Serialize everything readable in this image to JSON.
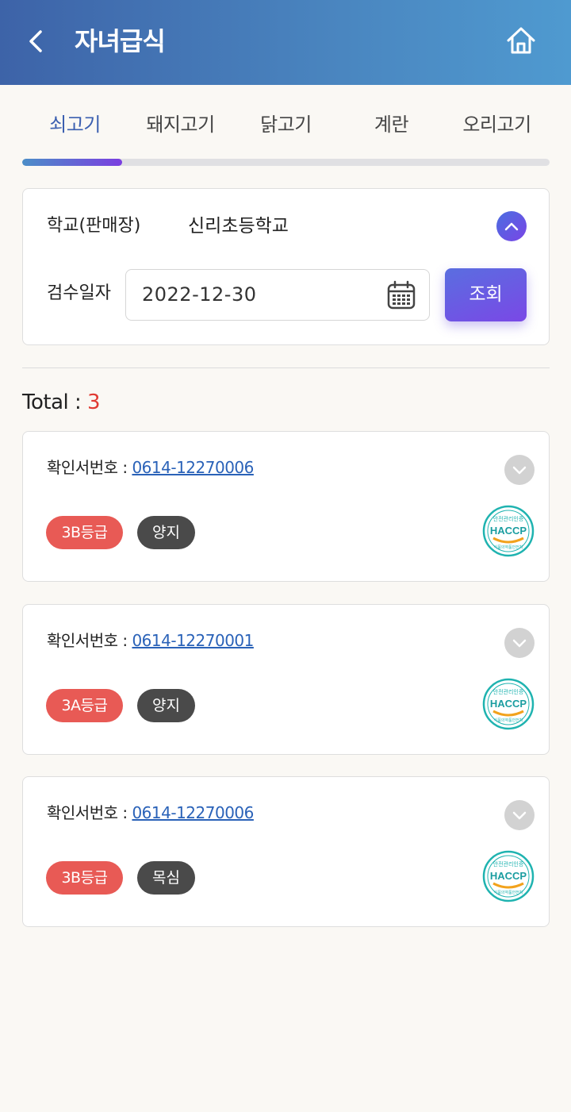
{
  "header": {
    "title": "자녀급식",
    "back_icon": "chevron-left-icon",
    "home_icon": "home-icon"
  },
  "tabs": [
    {
      "label": "쇠고기",
      "active": true
    },
    {
      "label": "돼지고기",
      "active": false
    },
    {
      "label": "닭고기",
      "active": false
    },
    {
      "label": "계란",
      "active": false
    },
    {
      "label": "오리고기",
      "active": false
    }
  ],
  "tab_progress": 0.19,
  "search": {
    "school_label": "학교(판매장)",
    "school_value": "신리초등학교",
    "date_label": "검수일자",
    "date_value": "2022-12-30",
    "submit_label": "조회"
  },
  "results": {
    "total_label": "Total : ",
    "total_count": "3",
    "items": [
      {
        "cert_label": "확인서번호 : ",
        "cert_no": "0614-12270006",
        "grade": "3B등급",
        "part": "양지",
        "cert_badge": "HACCP"
      },
      {
        "cert_label": "확인서번호 : ",
        "cert_no": "0614-12270001",
        "grade": "3A등급",
        "part": "양지",
        "cert_badge": "HACCP"
      },
      {
        "cert_label": "확인서번호 : ",
        "cert_no": "0614-12270006",
        "grade": "3B등급",
        "part": "목심",
        "cert_badge": "HACCP"
      }
    ]
  },
  "haccp_seal": {
    "top": "안전관리인증",
    "main": "HACCP",
    "bottom": "식품의약품안전처"
  },
  "colors": {
    "header_start": "#3d63a8",
    "header_end": "#4f9ad0",
    "accent": "#7a45e6",
    "total_count": "#e03a32",
    "grade_badge": "#e85a55",
    "part_badge": "#4a4a4a",
    "link": "#2a62b8",
    "haccp": "#1fb3b0"
  }
}
